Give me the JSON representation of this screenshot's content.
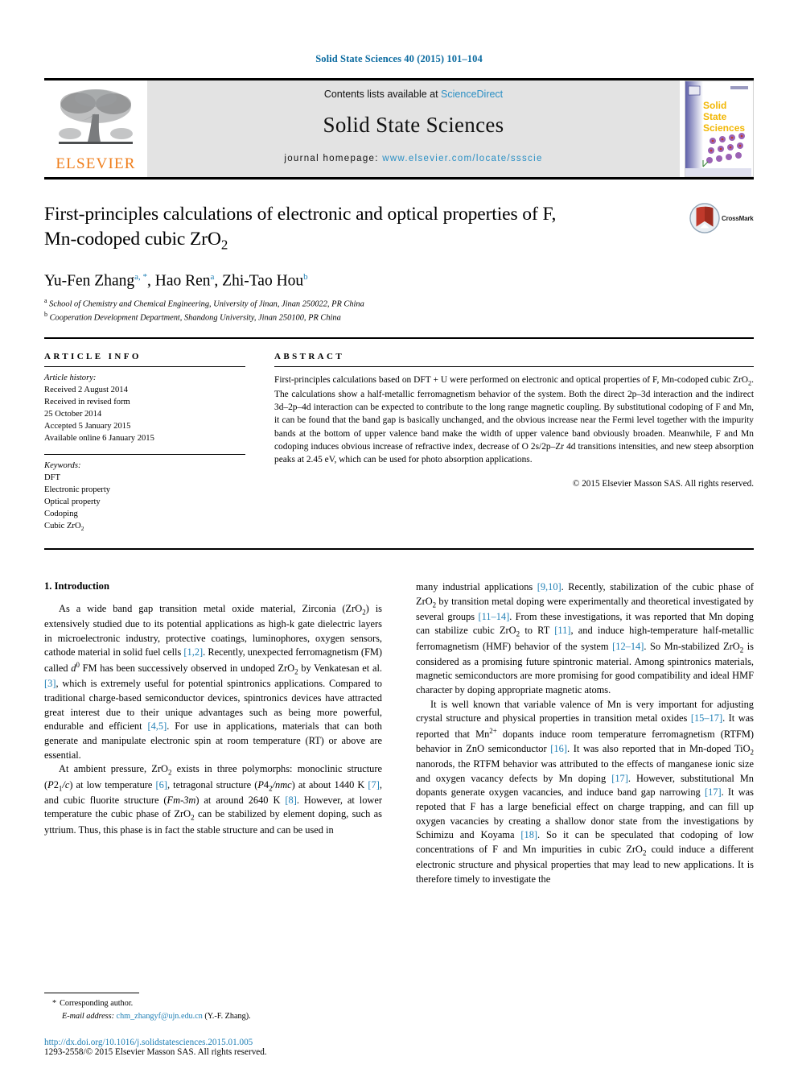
{
  "running_head": "Solid State Sciences 40 (2015) 101–104",
  "masthead": {
    "publisher": "ELSEVIER",
    "contents_prefix": "Contents lists available at ",
    "contents_link": "ScienceDirect",
    "journal_name": "Solid State Sciences",
    "homepage_prefix": "journal homepage: ",
    "homepage_url": "www.elsevier.com/locate/ssscie",
    "cover_title_lines": [
      "Solid",
      "State",
      "Sciences"
    ]
  },
  "article": {
    "title_line1": "First-principles calculations of electronic and optical properties of F,",
    "title_line2_a": "Mn-codoped cubic ZrO",
    "title_line2_sub": "2",
    "crossmark_label": "CrossMark",
    "authors": [
      {
        "name": "Yu-Fen Zhang",
        "marks": "a, *"
      },
      {
        "name": "Hao Ren",
        "marks": "a"
      },
      {
        "name": "Zhi-Tao Hou",
        "marks": "b"
      }
    ],
    "affiliations": [
      {
        "mark": "a",
        "text": "School of Chemistry and Chemical Engineering, University of Jinan, Jinan 250022, PR China"
      },
      {
        "mark": "b",
        "text": "Cooperation Development Department, Shandong University, Jinan 250100, PR China"
      }
    ]
  },
  "article_info": {
    "heading": "ARTICLE INFO",
    "history_label": "Article history:",
    "history": [
      "Received 2 August 2014",
      "Received in revised form",
      "25 October 2014",
      "Accepted 5 January 2015",
      "Available online 6 January 2015"
    ],
    "keywords_label": "Keywords:",
    "keywords": [
      "DFT",
      "Electronic property",
      "Optical property",
      "Codoping",
      "Cubic ZrO2"
    ]
  },
  "abstract": {
    "heading": "ABSTRACT",
    "text_parts": [
      "First-principles calculations based on DFT + U were performed on electronic and optical properties of F, Mn-codoped cubic ZrO",
      "2",
      ". The calculations show a half-metallic ferromagnetism behavior of the system. Both the direct 2p–3d interaction and the indirect 3d–2p–4d interaction can be expected to contribute to the long range magnetic coupling. By substitutional codoping of F and Mn, it can be found that the band gap is basically unchanged, and the obvious increase near the Fermi level together with the impurity bands at the bottom of upper valence band make the width of upper valence band obviously broaden. Meanwhile, F and Mn codoping induces obvious increase of refractive index, decrease of O 2s/2p–Zr 4d transitions intensities, and new steep absorption peaks at 2.45 eV, which can be used for photo absorption applications."
    ],
    "copyright": "© 2015 Elsevier Masson SAS. All rights reserved."
  },
  "body": {
    "section_heading": "1.  Introduction",
    "left_paragraphs": [
      "As a wide band gap transition metal oxide material, Zirconia (ZrO2) is extensively studied due to its potential applications as high-k gate dielectric layers in microelectronic industry, protective coatings, luminophores, oxygen sensors, cathode material in solid fuel cells [1,2]. Recently, unexpected ferromagnetism (FM) called d0 FM has been successively observed in undoped ZrO2 by Venkatesan et al. [3], which is extremely useful for potential spintronics applications. Compared to traditional charge-based semiconductor devices, spintronics devices have attracted great interest due to their unique advantages such as being more powerful, endurable and efficient [4,5]. For use in applications, materials that can both generate and manipulate electronic spin at room temperature (RT) or above are essential.",
      "At ambient pressure, ZrO2 exists in three polymorphs: monoclinic structure (P21/c) at low temperature [6], tetragonal structure (P42/nmc) at about 1440 K [7], and cubic fluorite structure (Fm-3m) at around 2640 K [8]. However, at lower temperature the cubic phase of ZrO2 can be stabilized by element doping, such as yttrium. Thus, this phase is in fact the stable structure and can be used in"
    ],
    "right_paragraphs": [
      "many industrial applications [9,10]. Recently, stabilization of the cubic phase of ZrO2 by transition metal doping were experimentally and theoretical investigated by several groups [11–14]. From these investigations, it was reported that Mn doping can stabilize cubic ZrO2 to RT [11], and induce high-temperature half-metallic ferromagnetism (HMF) behavior of the system [12–14]. So Mn-stabilized ZrO2 is considered as a promising future spintronic material. Among spintronics materials, magnetic semiconductors are more promising for good compatibility and ideal HMF character by doping appropriate magnetic atoms.",
      "It is well known that variable valence of Mn is very important for adjusting crystal structure and physical properties in transition metal oxides [15–17]. It was reported that Mn2+ dopants induce room temperature ferromagnetism (RTFM) behavior in ZnO semiconductor [16]. It was also reported that in Mn-doped TiO2 nanorods, the RTFM behavior was attributed to the effects of manganese ionic size and oxygen vacancy defects by Mn doping [17]. However, substitutional Mn dopants generate oxygen vacancies, and induce band gap narrowing [17]. It was repoted that F has a large beneficial effect on charge trapping, and can fill up oxygen vacancies by creating a shallow donor state from the investigations by Schimizu and Koyama [18]. So it can be speculated that codoping of low concentrations of F and Mn impurities in cubic ZrO2 could induce a different electronic structure and physical properties that may lead to new applications. It is therefore timely to investigate the"
    ]
  },
  "footnotes": {
    "corresponding_star": "*",
    "corresponding_label": "Corresponding author.",
    "email_label": "E-mail address:",
    "email": "chm_zhangyf@ujn.edu.cn",
    "email_author": "(Y.-F. Zhang)."
  },
  "footer": {
    "doi": "http://dx.doi.org/10.1016/j.solidstatesciences.2015.01.005",
    "issn_line": "1293-2558/© 2015 Elsevier Masson SAS. All rights reserved."
  },
  "colors": {
    "link": "#1f7fb5",
    "running_head": "#0b6ba0",
    "elsevier_orange": "#ef7d1a",
    "band_gray": "#e3e3e3"
  }
}
